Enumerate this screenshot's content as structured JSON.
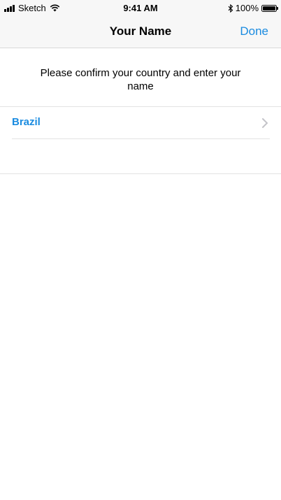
{
  "status_bar": {
    "carrier": "Sketch",
    "time": "9:41 AM",
    "battery_percent": "100%",
    "icons": [
      "signal-icon",
      "wifi-icon",
      "bluetooth-icon",
      "battery-icon"
    ]
  },
  "nav": {
    "title": "Your Name",
    "done_label": "Done"
  },
  "instruction": "Please confirm your country and enter your name",
  "country": {
    "label": "Brazil"
  },
  "colors": {
    "accent": "#1a8be0",
    "bar_background": "#f7f7f7",
    "divider": "#e2e2e2"
  }
}
